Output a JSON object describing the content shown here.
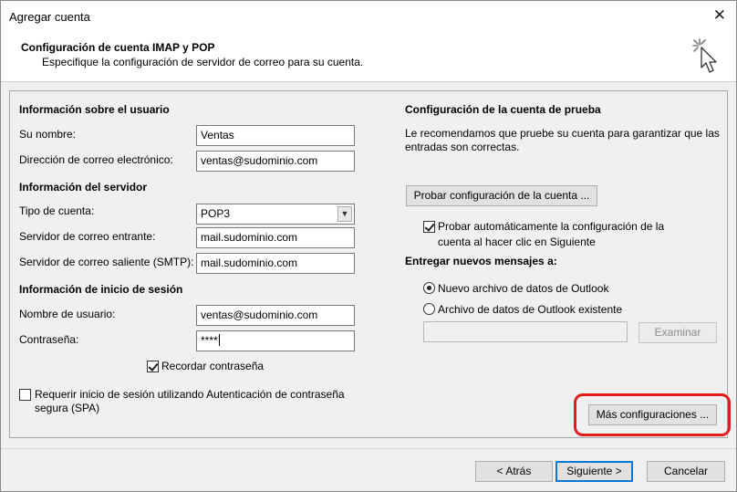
{
  "window": {
    "title": "Agregar cuenta",
    "close_glyph": "✕"
  },
  "header": {
    "title": "Configuración de cuenta IMAP y POP",
    "subtitle": "Especifique la configuración de servidor de correo para su cuenta.",
    "icon": "magic-wand-cursor-icon"
  },
  "user_info": {
    "heading": "Información sobre el usuario",
    "name_label": "Su nombre:",
    "name_value": "Ventas",
    "email_label": "Dirección de correo electrónico:",
    "email_value": "ventas@sudominio.com"
  },
  "server_info": {
    "heading": "Información del servidor",
    "account_type_label": "Tipo de cuenta:",
    "account_type_value": "POP3",
    "incoming_label": "Servidor de correo entrante:",
    "incoming_value": "mail.sudominio.com",
    "outgoing_label": "Servidor de correo saliente (SMTP):",
    "outgoing_value": "mail.sudominio.com"
  },
  "login_info": {
    "heading": "Información de inicio de sesión",
    "username_label": "Nombre de usuario:",
    "username_value": "ventas@sudominio.com",
    "password_label": "Contraseña:",
    "password_value": "****",
    "remember_label": "Recordar contraseña",
    "remember_checked": true,
    "spa_label_line1": "Requerir inicio de sesión utilizando Autenticación de contraseña",
    "spa_label_line2": "segura (SPA)",
    "spa_checked": false
  },
  "test": {
    "heading": "Configuración de la cuenta de prueba",
    "description_line1": "Le recomendamos que pruebe su cuenta para garantizar que las",
    "description_line2": "entradas son correctas.",
    "test_button": "Probar configuración de la cuenta ...",
    "auto_test_line1": "Probar automáticamente la configuración de la",
    "auto_test_line2": "cuenta al hacer clic en Siguiente",
    "auto_test_checked": true
  },
  "delivery": {
    "heading": "Entregar nuevos mensajes a:",
    "option_new": "Nuevo archivo de datos de Outlook",
    "option_existing": "Archivo de datos de Outlook existente",
    "selected": "new",
    "path_value": "",
    "browse_button": "Examinar"
  },
  "more_settings_button": "Más configuraciones ...",
  "highlight_color": "#e31b1b",
  "footer": {
    "back_button": "< Atrás",
    "next_button": "Siguiente >",
    "cancel_button": "Cancelar"
  }
}
